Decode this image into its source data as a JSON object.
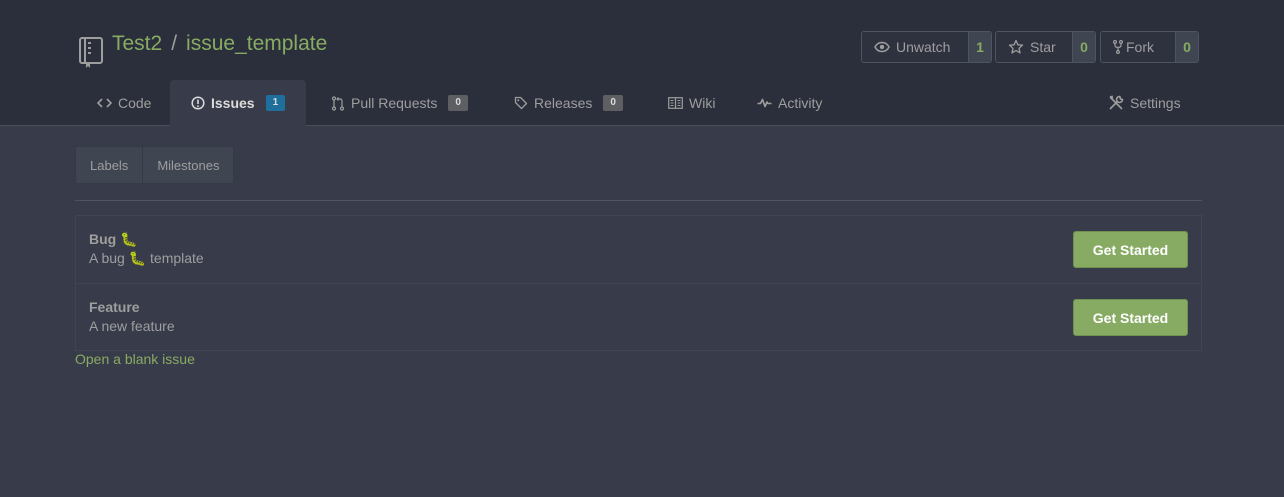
{
  "repo": {
    "owner": "Test2",
    "separator": "/",
    "name": "issue_template"
  },
  "actions": {
    "watch": {
      "label": "Unwatch",
      "count": "1"
    },
    "star": {
      "label": "Star",
      "count": "0"
    },
    "fork": {
      "label": "Fork",
      "count": "0"
    }
  },
  "tabs": [
    {
      "label": "Code",
      "icon": "code-icon"
    },
    {
      "label": "Issues",
      "icon": "issue-opened-icon",
      "count": "1",
      "active": true
    },
    {
      "label": "Pull Requests",
      "icon": "git-pull-request-icon",
      "count": "0"
    },
    {
      "label": "Releases",
      "icon": "tag-icon",
      "count": "0"
    },
    {
      "label": "Wiki",
      "icon": "book-icon"
    },
    {
      "label": "Activity",
      "icon": "pulse-icon"
    },
    {
      "label": "Settings",
      "icon": "tools-icon"
    }
  ],
  "subnav": {
    "labels": "Labels",
    "milestones": "Milestones"
  },
  "templates": [
    {
      "name": "Bug 🐛",
      "description": "A bug 🐛 template",
      "button": "Get Started"
    },
    {
      "name": "Feature",
      "description": "A new feature",
      "button": "Get Started"
    }
  ],
  "blank_issue_link": "Open a blank issue",
  "colors": {
    "accent": "#87ab63",
    "background": "#383c4a",
    "header": "#2b2f3b",
    "active_count": "#1f6f9d"
  }
}
